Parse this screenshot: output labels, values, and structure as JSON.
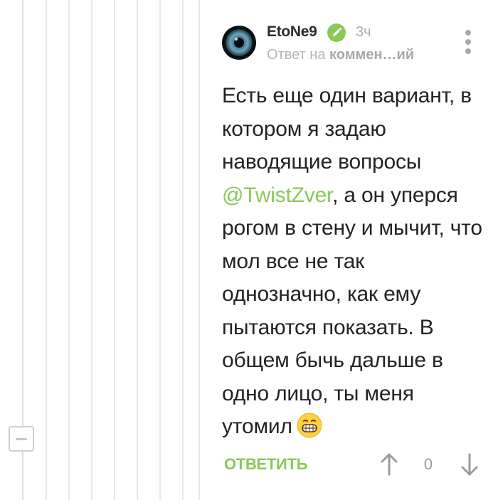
{
  "comment": {
    "author": "EtoNe9",
    "time": "3ч",
    "reply_prefix": "Ответ на",
    "reply_link": "коммен…ий",
    "text_before_mention": "Есть еще один вариант, в котором я задаю наводящие вопросы ",
    "mention": "@TwistZver",
    "text_after_mention": ", а он уперся рогом в стену и мычит, что мол все не так однозначно, как ему пытаются показать. В общем бычь дальше в одно лицо, ты меня утомил",
    "emoji": "grinning-face-emoji",
    "reply_label": "ОТВЕТИТЬ",
    "rating": "0"
  },
  "icons": {
    "verified": "verified-pencil-icon",
    "more": "more-vertical-icon",
    "vote_up": "arrow-up-icon",
    "vote_down": "arrow-down-icon",
    "collapse": "minus-icon"
  },
  "colors": {
    "accent": "#8ac858",
    "muted_text": "#aaaaaa",
    "thread_line": "#e8e8e8"
  }
}
